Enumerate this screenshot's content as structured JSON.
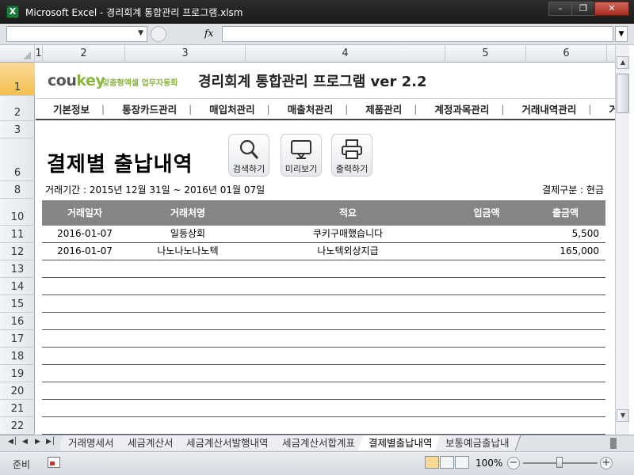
{
  "window": {
    "title": "Microsoft Excel - 경리회계 통합관리 프로그램.xlsm",
    "app_icon": "excel-icon",
    "buttons": [
      "minimize",
      "restore",
      "close"
    ]
  },
  "formula_bar": {
    "name_box": "",
    "fx": "fx",
    "formula": ""
  },
  "column_headers": [
    "1",
    "2",
    "3",
    "4",
    "5",
    "6"
  ],
  "row_headers": [
    "1",
    "2",
    "3",
    "6",
    "8",
    "10",
    "11",
    "12",
    "13",
    "14",
    "15",
    "16",
    "17",
    "18",
    "19",
    "20",
    "21",
    "22"
  ],
  "sheet": {
    "logo_main": "cou",
    "logo_key": "key",
    "logo_sub": "맞춤형엑셀 업무자동화",
    "app_title": "경리회계 통합관리 프로그램 ver 2.2",
    "menu": [
      "기본정보",
      "통장카드관리",
      "매입처관리",
      "매출처관리",
      "제품관리",
      "계정과목관리",
      "거래내역관리",
      "거래"
    ],
    "page_title": "결제별 출납내역",
    "buttons": {
      "search": "검색하기",
      "preview": "미리보기",
      "print": "출력하기"
    },
    "period": "거래기간 : 2015년 12월 31일 ~ 2016년 01월 07일",
    "payment_type": "결제구분 : 현금",
    "table": {
      "headers": [
        "거래일자",
        "거래처명",
        "적요",
        "입금액",
        "출금액"
      ],
      "rows": [
        [
          "2016-01-07",
          "일등상회",
          "쿠키구매했습니다",
          "",
          "5,500"
        ],
        [
          "2016-01-07",
          "나노나노나노텍",
          "나노텍외상지급",
          "",
          "165,000"
        ],
        [
          "",
          "",
          "",
          "",
          ""
        ],
        [
          "",
          "",
          "",
          "",
          ""
        ],
        [
          "",
          "",
          "",
          "",
          ""
        ],
        [
          "",
          "",
          "",
          "",
          ""
        ],
        [
          "",
          "",
          "",
          "",
          ""
        ],
        [
          "",
          "",
          "",
          "",
          ""
        ],
        [
          "",
          "",
          "",
          "",
          ""
        ],
        [
          "",
          "",
          "",
          "",
          ""
        ],
        [
          "",
          "",
          "",
          "",
          ""
        ],
        [
          "",
          "",
          "",
          "",
          ""
        ]
      ]
    }
  },
  "sheet_tabs": [
    "거래명세서",
    "세금계산서",
    "세금계산서발행내역",
    "세금계산서합계표",
    "결제별출납내역",
    "보통예금출납내"
  ],
  "active_tab": "결제별출납내역",
  "status": {
    "ready": "준비",
    "zoom": "100%"
  },
  "colors": {
    "logo_green": "#8bb53e",
    "table_header_bg": "#858585",
    "selected_row_header": "#f4c04e"
  }
}
